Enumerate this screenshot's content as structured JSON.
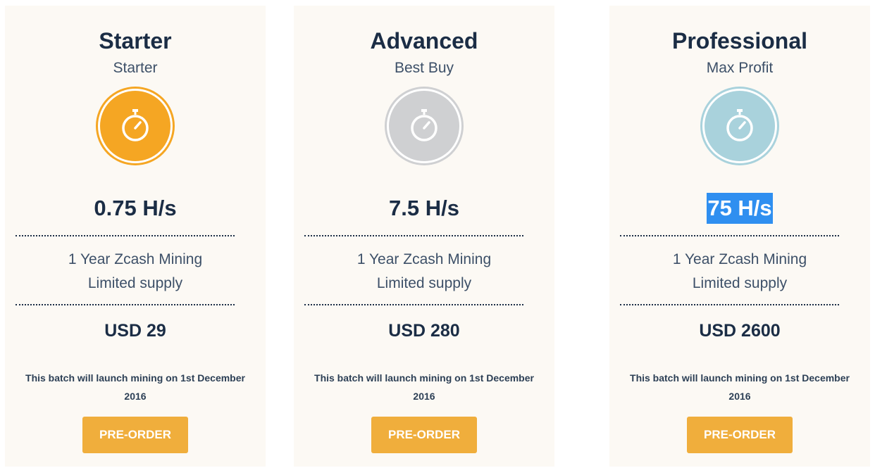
{
  "colors": {
    "card_bg": "#fcf9f4",
    "heading": "#1b2d45",
    "button": "#f0ae3c",
    "selection": "#2f8ff0"
  },
  "plans": [
    {
      "title": "Starter",
      "subtitle": "Starter",
      "icon": "stopwatch-icon",
      "icon_color": "#f5a623",
      "speed": "0.75 H/s",
      "features": [
        "1 Year Zcash Mining",
        "Limited supply"
      ],
      "price": "USD 29",
      "launch_note": "This batch will launch mining on 1st December 2016",
      "button_label": "PRE-ORDER"
    },
    {
      "title": "Advanced",
      "subtitle": "Best Buy",
      "icon": "stopwatch-icon",
      "icon_color": "#cfd0d2",
      "speed": "7.5 H/s",
      "features": [
        "1 Year Zcash Mining",
        "Limited supply"
      ],
      "price": "USD 280",
      "launch_note": "This batch will launch mining on 1st December 2016",
      "button_label": "PRE-ORDER"
    },
    {
      "title": "Professional",
      "subtitle": "Max Profit",
      "icon": "stopwatch-icon",
      "icon_color": "#a9d2dc",
      "speed": "75 H/s",
      "speed_selected": true,
      "features": [
        "1 Year Zcash Mining",
        "Limited supply"
      ],
      "price": "USD 2600",
      "launch_note": "This batch will launch mining on 1st December 2016",
      "button_label": "PRE-ORDER"
    }
  ]
}
